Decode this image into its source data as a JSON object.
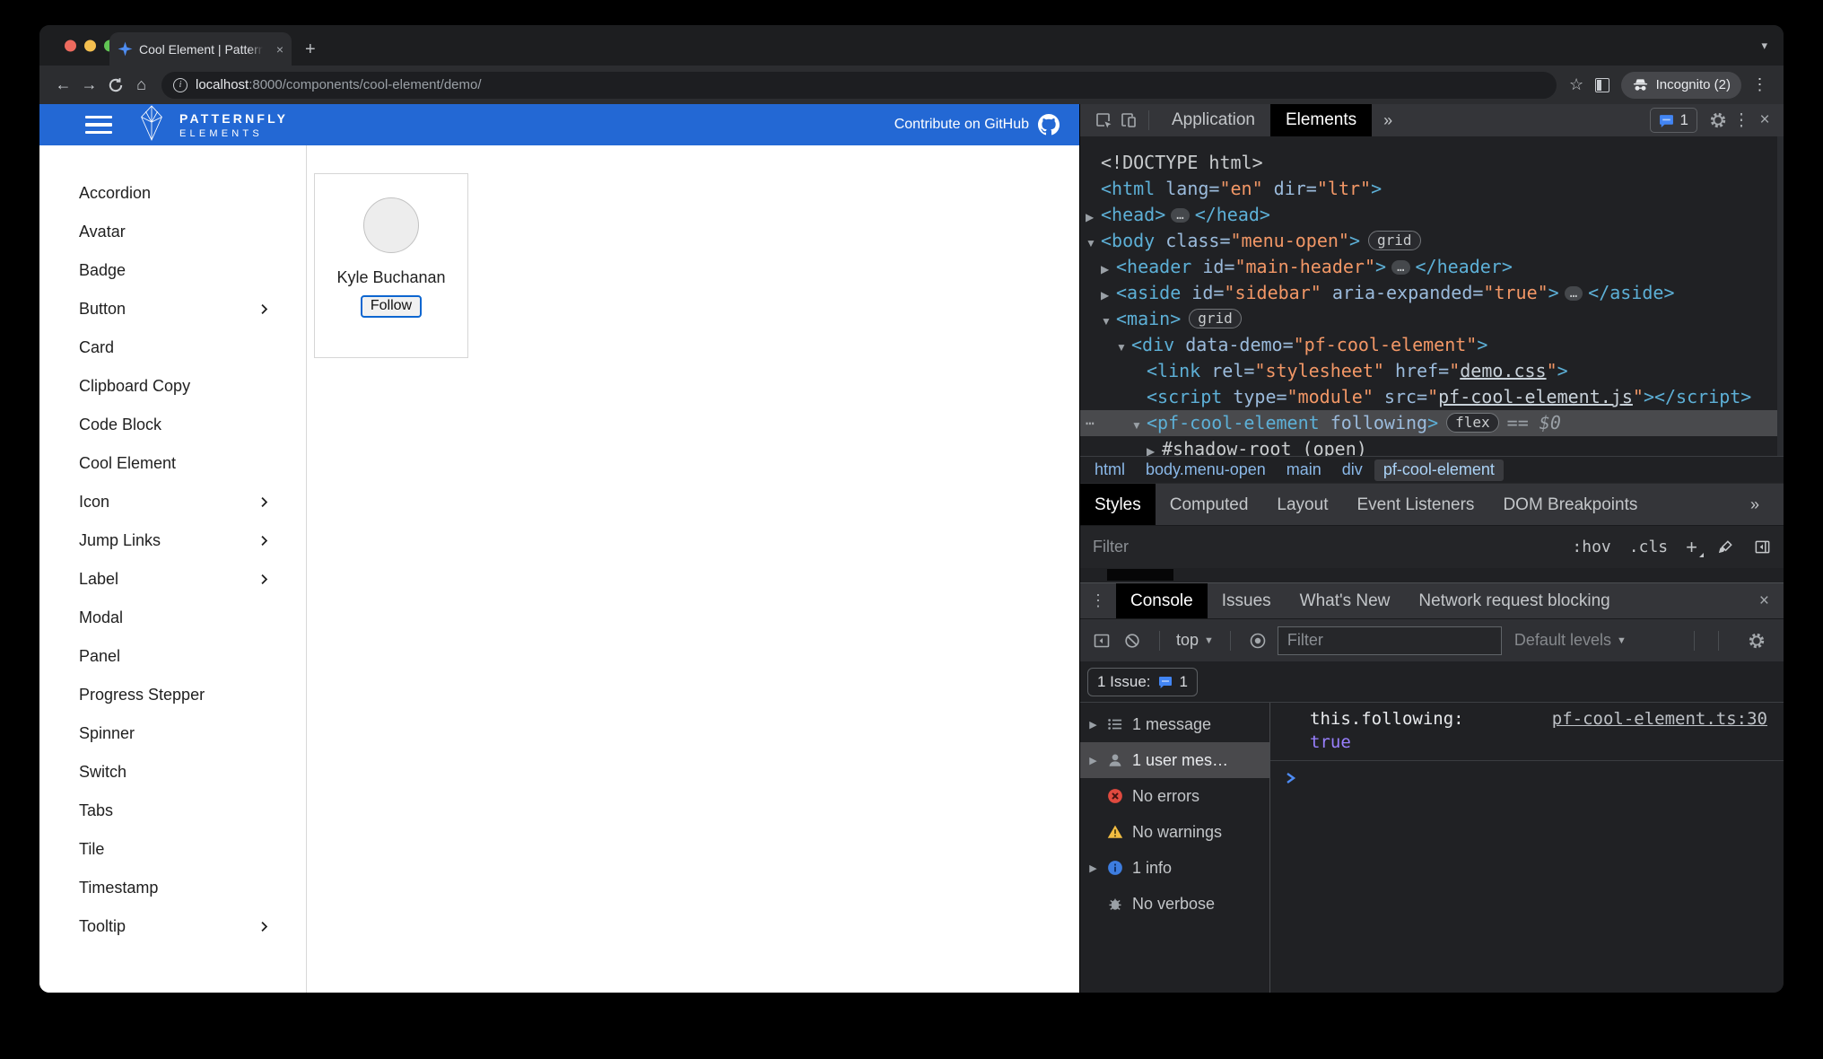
{
  "browser": {
    "tab": {
      "title": "Cool Element | PatternFly Eleme"
    },
    "url": {
      "host": "localhost",
      "path": ":8000/components/cool-element/demo/"
    },
    "incognito": "Incognito (2)"
  },
  "site_header": {
    "brand_top": "PATTERNFLY",
    "brand_bottom": "ELEMENTS",
    "contribute": "Contribute on GitHub",
    "accent": "#2368d4"
  },
  "sidebar": {
    "items": [
      {
        "label": "Accordion",
        "expandable": false
      },
      {
        "label": "Avatar",
        "expandable": false
      },
      {
        "label": "Badge",
        "expandable": false
      },
      {
        "label": "Button",
        "expandable": true
      },
      {
        "label": "Card",
        "expandable": false
      },
      {
        "label": "Clipboard Copy",
        "expandable": false
      },
      {
        "label": "Code Block",
        "expandable": false
      },
      {
        "label": "Cool Element",
        "expandable": false
      },
      {
        "label": "Icon",
        "expandable": true
      },
      {
        "label": "Jump Links",
        "expandable": true
      },
      {
        "label": "Label",
        "expandable": true
      },
      {
        "label": "Modal",
        "expandable": false
      },
      {
        "label": "Panel",
        "expandable": false
      },
      {
        "label": "Progress Stepper",
        "expandable": false
      },
      {
        "label": "Spinner",
        "expandable": false
      },
      {
        "label": "Switch",
        "expandable": false
      },
      {
        "label": "Tabs",
        "expandable": false
      },
      {
        "label": "Tile",
        "expandable": false
      },
      {
        "label": "Timestamp",
        "expandable": false
      },
      {
        "label": "Tooltip",
        "expandable": true
      }
    ]
  },
  "demo_card": {
    "name": "Kyle Buchanan",
    "button": "Follow"
  },
  "devtools": {
    "top_tabs": {
      "tabs": [
        "Application",
        "Elements"
      ],
      "active": "Elements",
      "issue_count": "1"
    },
    "elements_panel": {
      "lines": [
        {
          "ind": 0,
          "tk": [
            [
              "doc",
              "<!DOCTYPE html>"
            ]
          ]
        },
        {
          "ind": 0,
          "tk": [
            [
              "tag",
              "<html"
            ],
            [
              "attr",
              " lang="
            ],
            [
              "str",
              "\"en\""
            ],
            [
              "attr",
              " dir="
            ],
            [
              "str",
              "\"ltr\""
            ],
            [
              "tag",
              ">"
            ]
          ]
        },
        {
          "ind": 0,
          "arw": "r",
          "tk": [
            [
              "tag",
              "<head>"
            ],
            [
              "dots",
              "…"
            ],
            [
              "tag",
              "</head>"
            ]
          ]
        },
        {
          "ind": 0,
          "arw": "d",
          "tk": [
            [
              "tag",
              "<body"
            ],
            [
              "attr",
              " class="
            ],
            [
              "str",
              "\"menu-open\""
            ],
            [
              "tag",
              ">"
            ],
            [
              "bdg",
              "grid"
            ]
          ]
        },
        {
          "ind": 1,
          "arw": "r",
          "tk": [
            [
              "tag",
              "<header"
            ],
            [
              "attr",
              " id="
            ],
            [
              "str",
              "\"main-header\""
            ],
            [
              "tag",
              ">"
            ],
            [
              "dots",
              "…"
            ],
            [
              "tag",
              "</header>"
            ]
          ]
        },
        {
          "ind": 1,
          "arw": "r",
          "tk": [
            [
              "tag",
              "<aside"
            ],
            [
              "attr",
              " id="
            ],
            [
              "str",
              "\"sidebar\""
            ],
            [
              "attr",
              " aria-expanded="
            ],
            [
              "str",
              "\"true\""
            ],
            [
              "tag",
              ">"
            ],
            [
              "dots",
              "…"
            ],
            [
              "tag",
              "</aside>"
            ]
          ]
        },
        {
          "ind": 1,
          "arw": "d",
          "tk": [
            [
              "tag",
              "<main>"
            ],
            [
              "bdg",
              "grid"
            ]
          ]
        },
        {
          "ind": 2,
          "arw": "d",
          "tk": [
            [
              "tag",
              "<div"
            ],
            [
              "attr",
              " data-demo="
            ],
            [
              "str",
              "\"pf-cool-element\""
            ],
            [
              "tag",
              ">"
            ]
          ]
        },
        {
          "ind": 3,
          "tk": [
            [
              "tag",
              "<link"
            ],
            [
              "attr",
              " rel="
            ],
            [
              "str",
              "\"stylesheet\""
            ],
            [
              "attr",
              " href="
            ],
            [
              "str",
              "\""
            ],
            [
              "lnk",
              "demo.css"
            ],
            [
              "str",
              "\""
            ],
            [
              "tag",
              ">"
            ]
          ]
        },
        {
          "ind": 3,
          "tk": [
            [
              "tag",
              "<script"
            ],
            [
              "attr",
              " type="
            ],
            [
              "str",
              "\"module\""
            ],
            [
              "attr",
              " src="
            ],
            [
              "str",
              "\""
            ],
            [
              "lnk",
              "pf-cool-element.js"
            ],
            [
              "str",
              "\""
            ],
            [
              "tag",
              "></script>"
            ]
          ]
        },
        {
          "ind": 3,
          "arw": "d",
          "sel": true,
          "marker": "⋯",
          "tk": [
            [
              "tag",
              "<pf-cool-element"
            ],
            [
              "attr",
              " following"
            ],
            [
              "tag",
              ">"
            ],
            [
              "bdg",
              "flex"
            ],
            [
              "eq",
              "== $0"
            ]
          ]
        },
        {
          "ind": 4,
          "arw": "r",
          "tk": [
            [
              "doc",
              "#shadow-root (open)"
            ]
          ]
        }
      ]
    },
    "breadcrumbs": {
      "items": [
        "html",
        "body.menu-open",
        "main",
        "div",
        "pf-cool-element"
      ],
      "active": "pf-cool-element"
    },
    "styles_panel": {
      "tabs": [
        "Styles",
        "Computed",
        "Layout",
        "Event Listeners",
        "DOM Breakpoints"
      ],
      "active": "Styles",
      "filter_placeholder": "Filter",
      "pseudo_toggle": ":hov",
      "class_toggle": ".cls",
      "add_label": "+"
    },
    "console": {
      "tabs": [
        "Console",
        "Issues",
        "What's New",
        "Network request blocking"
      ],
      "active": "Console",
      "context": "top",
      "filter_placeholder": "Filter",
      "levels": "Default levels",
      "issue_summary": "1 Issue:",
      "issue_count": "1",
      "sidebar": [
        {
          "icon": "list",
          "label": "1 message",
          "expandable": true,
          "selected": false
        },
        {
          "icon": "user",
          "label": "1 user mes…",
          "expandable": true,
          "selected": true
        },
        {
          "icon": "error",
          "label": "No errors",
          "expandable": false,
          "selected": false
        },
        {
          "icon": "warning",
          "label": "No warnings",
          "expandable": false,
          "selected": false
        },
        {
          "icon": "info",
          "label": "1 info",
          "expandable": true,
          "selected": false
        },
        {
          "icon": "verbose",
          "label": "No verbose",
          "expandable": false,
          "selected": false
        }
      ],
      "message": {
        "label": "this.following:",
        "value": "true",
        "source": "pf-cool-element.ts:30"
      }
    }
  }
}
